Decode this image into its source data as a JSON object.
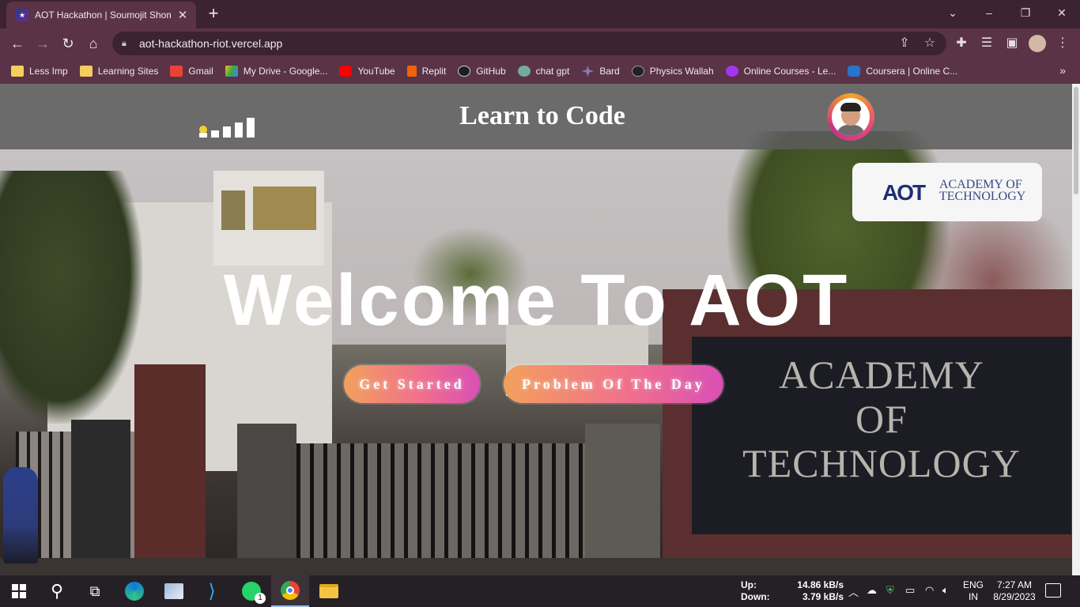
{
  "browser": {
    "tab_title": "AOT Hackathon | Soumojit Shome",
    "tab_close": "✕",
    "new_tab": "+",
    "window_controls": {
      "minimize": "–",
      "restore": "❐",
      "close": "✕",
      "dropdown": "⌄"
    },
    "url": "aot-hackathon-riot.vercel.app",
    "bookmarks": [
      {
        "label": "Less Imp",
        "icon": "folder-icon",
        "color": "#f5cf5b"
      },
      {
        "label": "Learning Sites",
        "icon": "folder-icon",
        "color": "#f5cf5b"
      },
      {
        "label": "Gmail",
        "icon": "gmail-icon",
        "color": "#ea4335"
      },
      {
        "label": "My Drive - Google...",
        "icon": "drive-icon",
        "color": "#34a853"
      },
      {
        "label": "YouTube",
        "icon": "youtube-icon",
        "color": "#ff0000"
      },
      {
        "label": "Replit",
        "icon": "replit-icon",
        "color": "#f26207"
      },
      {
        "label": "GitHub",
        "icon": "github-icon",
        "color": "#1b1f23"
      },
      {
        "label": "chat gpt",
        "icon": "chatgpt-icon",
        "color": "#74aa9c"
      },
      {
        "label": "Bard",
        "icon": "bard-icon",
        "color": "#8ab4f8"
      },
      {
        "label": "Physics Wallah",
        "icon": "pw-icon",
        "color": "#222222"
      },
      {
        "label": "Online Courses - Le...",
        "icon": "udemy-icon",
        "color": "#a435f0"
      },
      {
        "label": "Coursera | Online C...",
        "icon": "coursera-icon",
        "color": "#2a73cc"
      }
    ],
    "bookmarks_more": "»"
  },
  "page": {
    "site_title": "Learn to Code",
    "logo_mark": "AOT",
    "logo_line1": "ACADEMY OF",
    "logo_line2": "TECHNOLOGY",
    "welcome": "Welcome To AOT",
    "cta_primary": "Get Started",
    "cta_secondary": "Problem Of The Day",
    "sign_line1": "ACADEMY",
    "sign_line2": "OF",
    "sign_line3": "TECHNOLOGY"
  },
  "taskbar": {
    "up_label": "Up:",
    "down_label": "Down:",
    "up_value": "14.86 kB/s",
    "down_value": "3.79 kB/s",
    "lang_1": "ENG",
    "lang_2": "IN",
    "time": "7:27 AM",
    "date": "8/29/2023",
    "whatsapp_badge": "1"
  },
  "colors": {
    "chrome_dark": "#3c2331",
    "chrome_mid": "#5a3347",
    "cta_gradient_start": "#f3a05c",
    "cta_gradient_end": "#d94fb5",
    "signal_dot": "#f2d22d"
  }
}
